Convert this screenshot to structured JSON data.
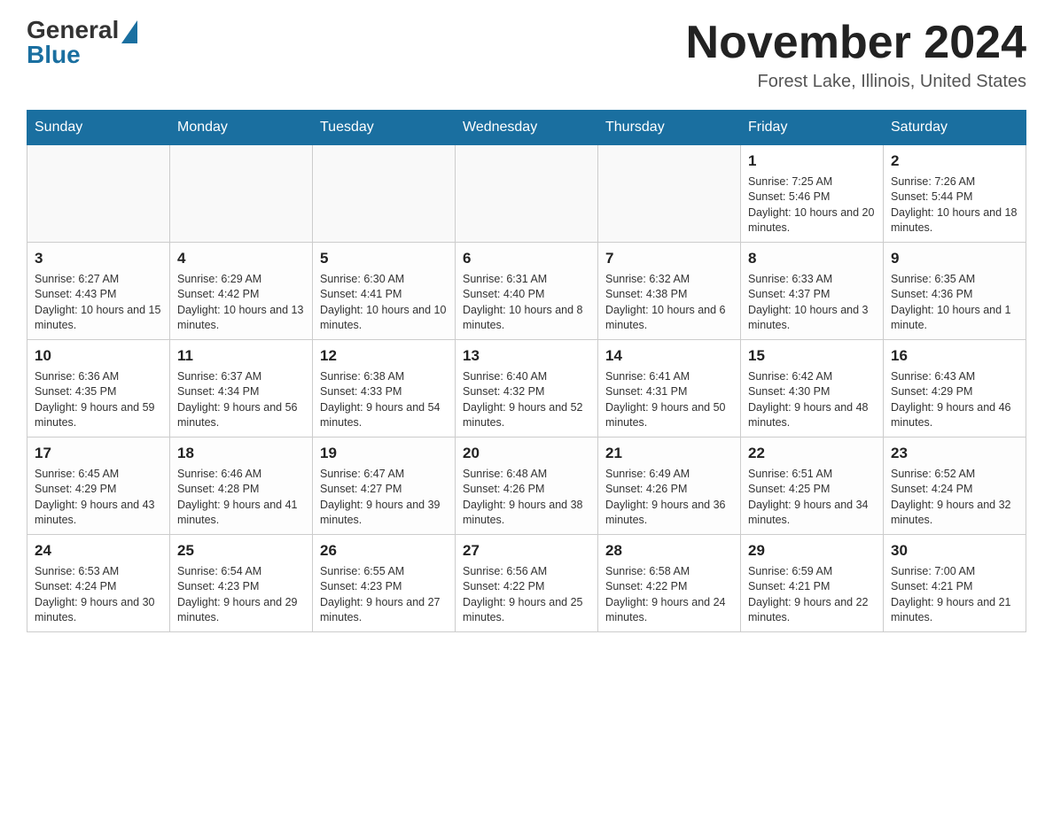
{
  "header": {
    "logo_general": "General",
    "logo_blue": "Blue",
    "month_title": "November 2024",
    "location": "Forest Lake, Illinois, United States"
  },
  "days_of_week": [
    "Sunday",
    "Monday",
    "Tuesday",
    "Wednesday",
    "Thursday",
    "Friday",
    "Saturday"
  ],
  "weeks": [
    [
      {
        "day": "",
        "info": ""
      },
      {
        "day": "",
        "info": ""
      },
      {
        "day": "",
        "info": ""
      },
      {
        "day": "",
        "info": ""
      },
      {
        "day": "",
        "info": ""
      },
      {
        "day": "1",
        "info": "Sunrise: 7:25 AM\nSunset: 5:46 PM\nDaylight: 10 hours and 20 minutes."
      },
      {
        "day": "2",
        "info": "Sunrise: 7:26 AM\nSunset: 5:44 PM\nDaylight: 10 hours and 18 minutes."
      }
    ],
    [
      {
        "day": "3",
        "info": "Sunrise: 6:27 AM\nSunset: 4:43 PM\nDaylight: 10 hours and 15 minutes."
      },
      {
        "day": "4",
        "info": "Sunrise: 6:29 AM\nSunset: 4:42 PM\nDaylight: 10 hours and 13 minutes."
      },
      {
        "day": "5",
        "info": "Sunrise: 6:30 AM\nSunset: 4:41 PM\nDaylight: 10 hours and 10 minutes."
      },
      {
        "day": "6",
        "info": "Sunrise: 6:31 AM\nSunset: 4:40 PM\nDaylight: 10 hours and 8 minutes."
      },
      {
        "day": "7",
        "info": "Sunrise: 6:32 AM\nSunset: 4:38 PM\nDaylight: 10 hours and 6 minutes."
      },
      {
        "day": "8",
        "info": "Sunrise: 6:33 AM\nSunset: 4:37 PM\nDaylight: 10 hours and 3 minutes."
      },
      {
        "day": "9",
        "info": "Sunrise: 6:35 AM\nSunset: 4:36 PM\nDaylight: 10 hours and 1 minute."
      }
    ],
    [
      {
        "day": "10",
        "info": "Sunrise: 6:36 AM\nSunset: 4:35 PM\nDaylight: 9 hours and 59 minutes."
      },
      {
        "day": "11",
        "info": "Sunrise: 6:37 AM\nSunset: 4:34 PM\nDaylight: 9 hours and 56 minutes."
      },
      {
        "day": "12",
        "info": "Sunrise: 6:38 AM\nSunset: 4:33 PM\nDaylight: 9 hours and 54 minutes."
      },
      {
        "day": "13",
        "info": "Sunrise: 6:40 AM\nSunset: 4:32 PM\nDaylight: 9 hours and 52 minutes."
      },
      {
        "day": "14",
        "info": "Sunrise: 6:41 AM\nSunset: 4:31 PM\nDaylight: 9 hours and 50 minutes."
      },
      {
        "day": "15",
        "info": "Sunrise: 6:42 AM\nSunset: 4:30 PM\nDaylight: 9 hours and 48 minutes."
      },
      {
        "day": "16",
        "info": "Sunrise: 6:43 AM\nSunset: 4:29 PM\nDaylight: 9 hours and 46 minutes."
      }
    ],
    [
      {
        "day": "17",
        "info": "Sunrise: 6:45 AM\nSunset: 4:29 PM\nDaylight: 9 hours and 43 minutes."
      },
      {
        "day": "18",
        "info": "Sunrise: 6:46 AM\nSunset: 4:28 PM\nDaylight: 9 hours and 41 minutes."
      },
      {
        "day": "19",
        "info": "Sunrise: 6:47 AM\nSunset: 4:27 PM\nDaylight: 9 hours and 39 minutes."
      },
      {
        "day": "20",
        "info": "Sunrise: 6:48 AM\nSunset: 4:26 PM\nDaylight: 9 hours and 38 minutes."
      },
      {
        "day": "21",
        "info": "Sunrise: 6:49 AM\nSunset: 4:26 PM\nDaylight: 9 hours and 36 minutes."
      },
      {
        "day": "22",
        "info": "Sunrise: 6:51 AM\nSunset: 4:25 PM\nDaylight: 9 hours and 34 minutes."
      },
      {
        "day": "23",
        "info": "Sunrise: 6:52 AM\nSunset: 4:24 PM\nDaylight: 9 hours and 32 minutes."
      }
    ],
    [
      {
        "day": "24",
        "info": "Sunrise: 6:53 AM\nSunset: 4:24 PM\nDaylight: 9 hours and 30 minutes."
      },
      {
        "day": "25",
        "info": "Sunrise: 6:54 AM\nSunset: 4:23 PM\nDaylight: 9 hours and 29 minutes."
      },
      {
        "day": "26",
        "info": "Sunrise: 6:55 AM\nSunset: 4:23 PM\nDaylight: 9 hours and 27 minutes."
      },
      {
        "day": "27",
        "info": "Sunrise: 6:56 AM\nSunset: 4:22 PM\nDaylight: 9 hours and 25 minutes."
      },
      {
        "day": "28",
        "info": "Sunrise: 6:58 AM\nSunset: 4:22 PM\nDaylight: 9 hours and 24 minutes."
      },
      {
        "day": "29",
        "info": "Sunrise: 6:59 AM\nSunset: 4:21 PM\nDaylight: 9 hours and 22 minutes."
      },
      {
        "day": "30",
        "info": "Sunrise: 7:00 AM\nSunset: 4:21 PM\nDaylight: 9 hours and 21 minutes."
      }
    ]
  ]
}
